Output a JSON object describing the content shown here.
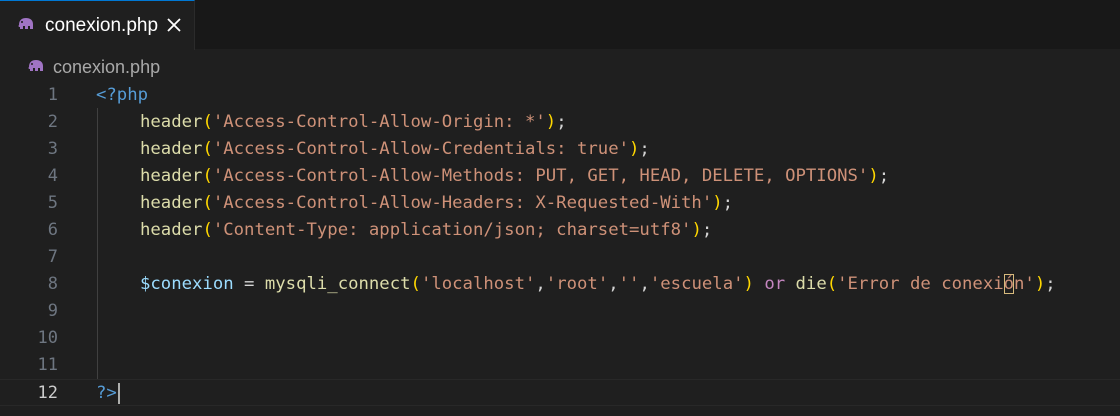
{
  "tab": {
    "label": "conexion.php",
    "icon": "php-elephant-icon",
    "close_icon": "close-icon",
    "icon_color": "#a074c4"
  },
  "breadcrumb": {
    "label": "conexion.php",
    "icon": "php-elephant-icon"
  },
  "editor": {
    "current_line": 12,
    "lines": [
      {
        "n": "1",
        "parts": [
          [
            "kw-php",
            "<?php"
          ]
        ]
      },
      {
        "n": "2",
        "parts": [
          [
            "fn",
            "header"
          ],
          [
            "p1",
            "("
          ],
          [
            "str",
            "'Access-Control-Allow-Origin: *'"
          ],
          [
            "p1",
            ")"
          ],
          [
            "op",
            ";"
          ]
        ]
      },
      {
        "n": "3",
        "parts": [
          [
            "fn",
            "header"
          ],
          [
            "p1",
            "("
          ],
          [
            "str",
            "'Access-Control-Allow-Credentials: true'"
          ],
          [
            "p1",
            ")"
          ],
          [
            "op",
            ";"
          ]
        ]
      },
      {
        "n": "4",
        "parts": [
          [
            "fn",
            "header"
          ],
          [
            "p1",
            "("
          ],
          [
            "str",
            "'Access-Control-Allow-Methods: PUT, GET, HEAD, DELETE, OPTIONS'"
          ],
          [
            "p1",
            ")"
          ],
          [
            "op",
            ";"
          ]
        ]
      },
      {
        "n": "5",
        "parts": [
          [
            "fn",
            "header"
          ],
          [
            "p1",
            "("
          ],
          [
            "str",
            "'Access-Control-Allow-Headers: X-Requested-With'"
          ],
          [
            "p1",
            ")"
          ],
          [
            "op",
            ";"
          ]
        ]
      },
      {
        "n": "6",
        "parts": [
          [
            "fn",
            "header"
          ],
          [
            "p1",
            "("
          ],
          [
            "str",
            "'Content-Type: application/json; charset=utf8'"
          ],
          [
            "p1",
            ")"
          ],
          [
            "op",
            ";"
          ]
        ]
      },
      {
        "n": "7",
        "parts": []
      },
      {
        "n": "8",
        "parts": [
          [
            "var",
            "$conexion"
          ],
          [
            "op",
            " = "
          ],
          [
            "fn",
            "mysqli_connect"
          ],
          [
            "p1",
            "("
          ],
          [
            "str",
            "'localhost'"
          ],
          [
            "op",
            ","
          ],
          [
            "str",
            "'root'"
          ],
          [
            "op",
            ","
          ],
          [
            "str",
            "''"
          ],
          [
            "op",
            ","
          ],
          [
            "str",
            "'escuela'"
          ],
          [
            "p1",
            ")"
          ],
          [
            "op",
            " "
          ],
          [
            "ctl",
            "or"
          ],
          [
            "op",
            " "
          ],
          [
            "fn",
            "die"
          ],
          [
            "p1",
            "("
          ],
          [
            "str",
            "'Error de conexi"
          ],
          [
            "str bracket-box",
            "ó"
          ],
          [
            "str",
            "n'"
          ],
          [
            "p1",
            ")"
          ],
          [
            "op",
            ";"
          ]
        ]
      },
      {
        "n": "9",
        "parts": []
      },
      {
        "n": "10",
        "parts": []
      },
      {
        "n": "11",
        "parts": []
      },
      {
        "n": "12",
        "parts": [
          [
            "kw-php",
            "?>"
          ]
        ]
      }
    ]
  }
}
